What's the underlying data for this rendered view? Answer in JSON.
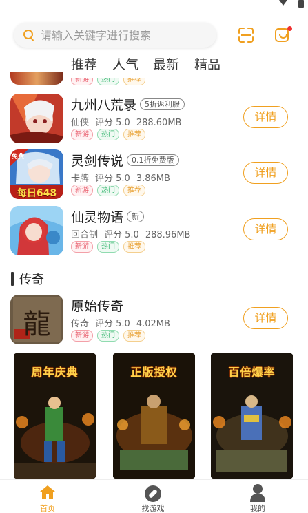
{
  "search": {
    "placeholder": "请输入关键字进行搜索"
  },
  "tabs": [
    "推荐",
    "人气",
    "最新",
    "精品"
  ],
  "tag_labels": {
    "new": "新游",
    "hot": "热门",
    "rec": "推荐"
  },
  "games": [
    {
      "name": "九州八荒录",
      "badge": "5折返利服",
      "category": "仙侠",
      "rating": "评分 5.0",
      "size": "288.60MB",
      "button": "详情"
    },
    {
      "name": "灵剑传说",
      "badge": "0.1折免费版",
      "category": "卡牌",
      "rating": "评分 5.0",
      "size": "3.86MB",
      "button": "详情",
      "thumb_text": "每日648",
      "thumb_corner": "免费"
    },
    {
      "name": "仙灵物语",
      "badge": "新",
      "category": "回合制",
      "rating": "评分 5.0",
      "size": "288.96MB",
      "button": "详情"
    }
  ],
  "section": {
    "title": "传奇",
    "games": [
      {
        "name": "原始传奇",
        "category": "传奇",
        "rating": "评分 5.0",
        "size": "4.02MB",
        "button": "详情",
        "thumb_text": "龍"
      }
    ]
  },
  "banners": [
    {
      "title": "周年庆典"
    },
    {
      "title": "正版授权"
    },
    {
      "title": "百倍爆率"
    }
  ],
  "nav": [
    {
      "label": "首页",
      "active": true,
      "icon": "home-icon"
    },
    {
      "label": "找游戏",
      "active": false,
      "icon": "compass-icon"
    },
    {
      "label": "我的",
      "active": false,
      "icon": "user-icon"
    }
  ],
  "colors": {
    "accent": "#f0a020",
    "tag_new": "#e85a6a",
    "tag_hot": "#2fb36a",
    "tag_rec": "#e9a43a"
  }
}
